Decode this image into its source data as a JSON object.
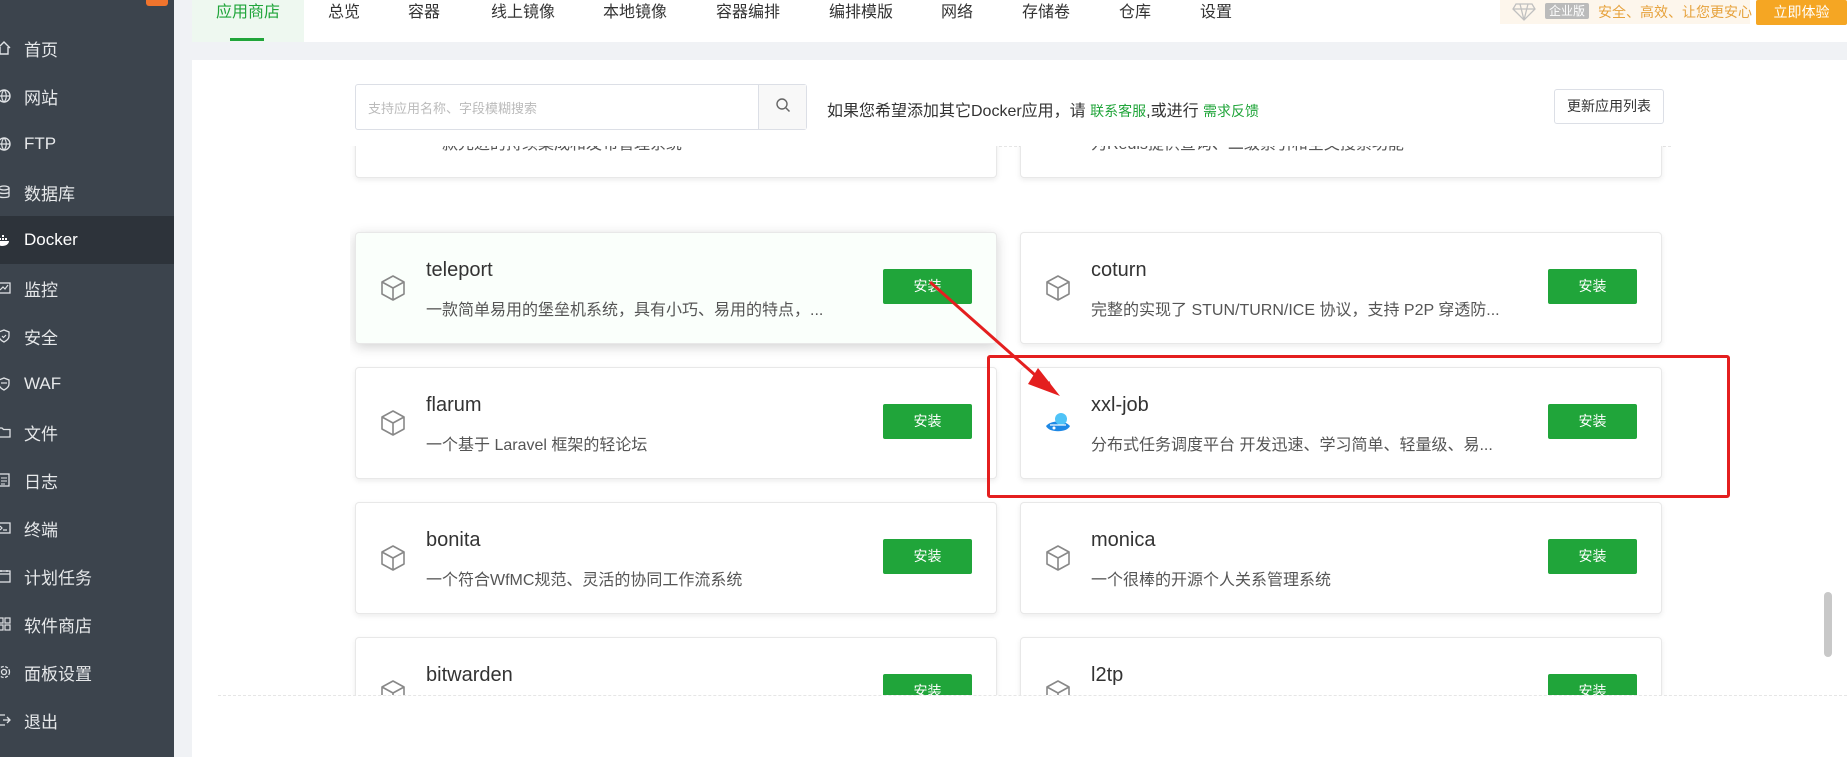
{
  "sidebar": {
    "items": [
      {
        "label": "首页",
        "icon": "home-icon"
      },
      {
        "label": "网站",
        "icon": "globe-icon"
      },
      {
        "label": "FTP",
        "icon": "globe-icon"
      },
      {
        "label": "数据库",
        "icon": "database-icon"
      },
      {
        "label": "Docker",
        "icon": "docker-icon",
        "active": true
      },
      {
        "label": "监控",
        "icon": "monitor-icon"
      },
      {
        "label": "安全",
        "icon": "shield-icon"
      },
      {
        "label": "WAF",
        "icon": "waf-shield-icon"
      },
      {
        "label": "文件",
        "icon": "folder-icon"
      },
      {
        "label": "日志",
        "icon": "log-icon"
      },
      {
        "label": "终端",
        "icon": "terminal-icon"
      },
      {
        "label": "计划任务",
        "icon": "calendar-icon"
      },
      {
        "label": "软件商店",
        "icon": "grid-icon"
      },
      {
        "label": "面板设置",
        "icon": "gear-icon"
      },
      {
        "label": "退出",
        "icon": "exit-icon"
      }
    ]
  },
  "tabs": [
    "应用商店",
    "总览",
    "容器",
    "线上镜像",
    "本地镜像",
    "容器编排",
    "编排模版",
    "网络",
    "存储卷",
    "仓库",
    "设置"
  ],
  "enterprise": {
    "label": "企业版",
    "slogan": "安全、高效、让您更安心",
    "button": "立即体验"
  },
  "search": {
    "placeholder": "支持应用名称、字段模糊搜索"
  },
  "hint": {
    "text": "如果您希望添加其它Docker应用，请",
    "link1": "联系客服",
    "middle": ",或进行",
    "link2": "需求反馈"
  },
  "refresh_label": "更新应用列表",
  "install_label": "安装",
  "cards": [
    {
      "title": "",
      "desc": "一款先进的持续集成和发布管理系统",
      "partial": true
    },
    {
      "title": "",
      "desc": "为Redis提供查询、二级索引和全文搜索功能",
      "partial": true
    },
    {
      "title": "teleport",
      "desc": "一款简单易用的堡垒机系统，具有小巧、易用的特点，..."
    },
    {
      "title": "coturn",
      "desc": "完整的实现了 STUN/TURN/ICE 协议，支持 P2P 穿透防..."
    },
    {
      "title": "flarum",
      "desc": "一个基于 Laravel 框架的轻论坛"
    },
    {
      "title": "xxl-job",
      "desc": "分布式任务调度平台 开发迅速、学习简单、轻量级、易..."
    },
    {
      "title": "bonita",
      "desc": "一个符合WfMC规范、灵活的协同工作流系统"
    },
    {
      "title": "monica",
      "desc": "一个很棒的开源个人关系管理系统"
    },
    {
      "title": "bitwarden",
      "desc": ""
    },
    {
      "title": "l2tp",
      "desc": ""
    }
  ],
  "colors": {
    "accent": "#20a53a",
    "annotation": "#e41f1f",
    "sidebar": "#3c444d",
    "enterprise": "#f5a623"
  }
}
